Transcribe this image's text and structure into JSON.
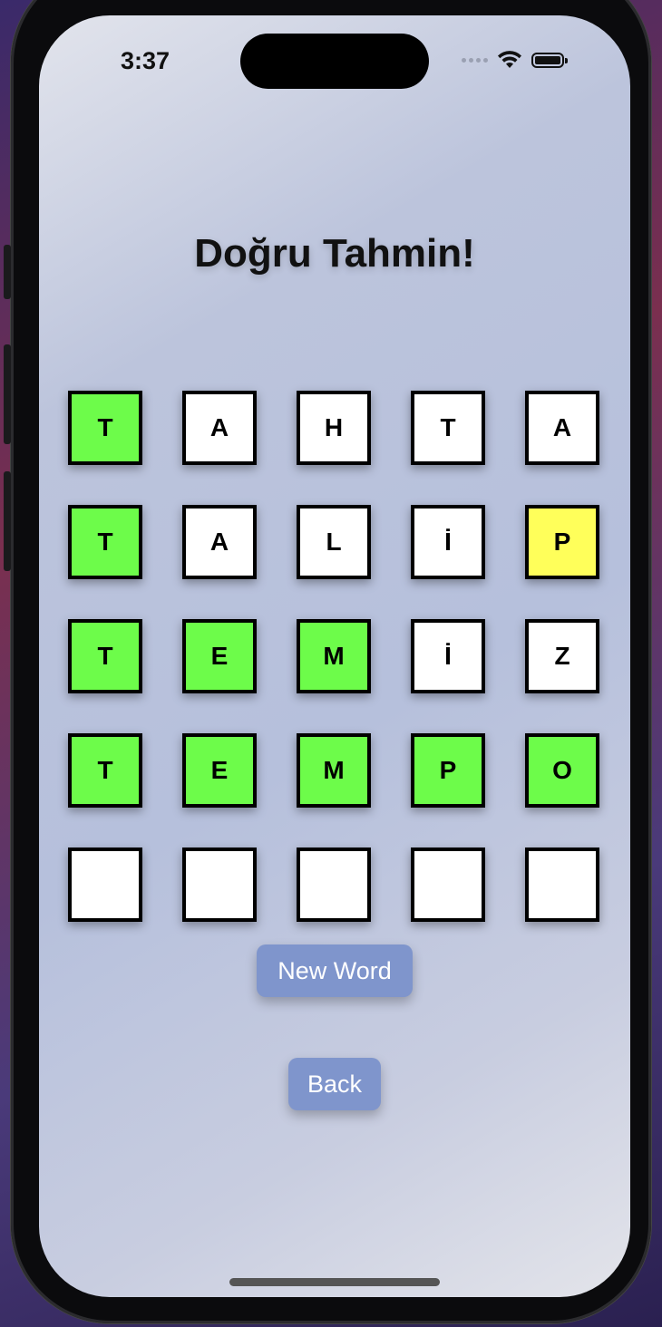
{
  "status_bar": {
    "time": "3:37"
  },
  "game": {
    "title": "Doğru Tahmin!",
    "rows": [
      [
        {
          "letter": "T",
          "state": "green"
        },
        {
          "letter": "A",
          "state": "white"
        },
        {
          "letter": "H",
          "state": "white"
        },
        {
          "letter": "T",
          "state": "white"
        },
        {
          "letter": "A",
          "state": "white"
        }
      ],
      [
        {
          "letter": "T",
          "state": "green"
        },
        {
          "letter": "A",
          "state": "white"
        },
        {
          "letter": "L",
          "state": "white"
        },
        {
          "letter": "İ",
          "state": "white"
        },
        {
          "letter": "P",
          "state": "yellow"
        }
      ],
      [
        {
          "letter": "T",
          "state": "green"
        },
        {
          "letter": "E",
          "state": "green"
        },
        {
          "letter": "M",
          "state": "green"
        },
        {
          "letter": "İ",
          "state": "white"
        },
        {
          "letter": "Z",
          "state": "white"
        }
      ],
      [
        {
          "letter": "T",
          "state": "green"
        },
        {
          "letter": "E",
          "state": "green"
        },
        {
          "letter": "M",
          "state": "green"
        },
        {
          "letter": "P",
          "state": "green"
        },
        {
          "letter": "O",
          "state": "green"
        }
      ],
      [
        {
          "letter": "",
          "state": "white"
        },
        {
          "letter": "",
          "state": "white"
        },
        {
          "letter": "",
          "state": "white"
        },
        {
          "letter": "",
          "state": "white"
        },
        {
          "letter": "",
          "state": "white"
        }
      ]
    ]
  },
  "buttons": {
    "new_word": "New Word",
    "back": "Back"
  },
  "colors": {
    "correct": "#6dfc4a",
    "present": "#ffff5a",
    "absent": "#ffffff",
    "button": "#7f95cc"
  },
  "icons": {
    "signal": "cellular-dots-icon",
    "wifi": "wifi-icon",
    "battery": "battery-icon"
  }
}
